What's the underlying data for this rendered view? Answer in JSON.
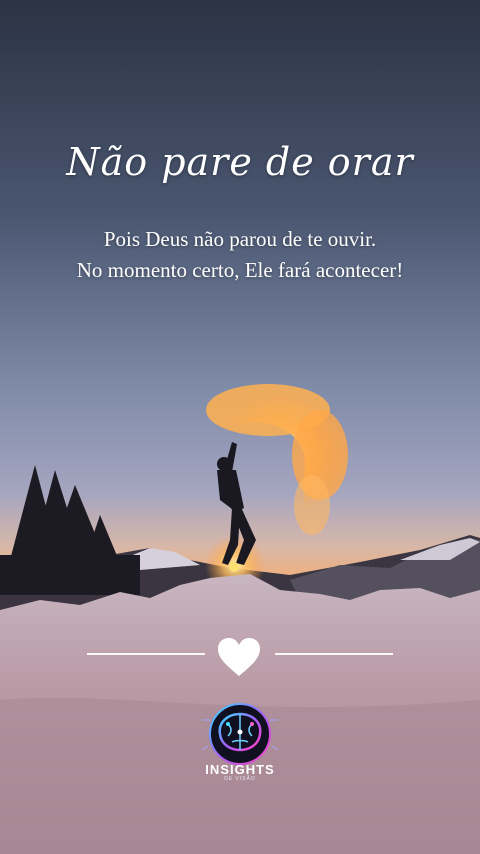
{
  "post": {
    "title": "Não pare de orar",
    "subtitle_line1": "Pois Deus não parou de te ouvir.",
    "subtitle_line2": "No momento certo, Ele fará acontecer!"
  },
  "brand": {
    "name": "INSIGHTS",
    "tagline": "DE VISÃO"
  },
  "icons": {
    "divider_icon": "heart-icon",
    "logo_icon": "brain-circuit-icon"
  },
  "colors": {
    "sky_top": "#2d3a4f",
    "sky_mid": "#6a7a96",
    "sky_horizon": "#f2a66a",
    "fire": "#ff9a3c",
    "snow": "#d9c9cf"
  }
}
